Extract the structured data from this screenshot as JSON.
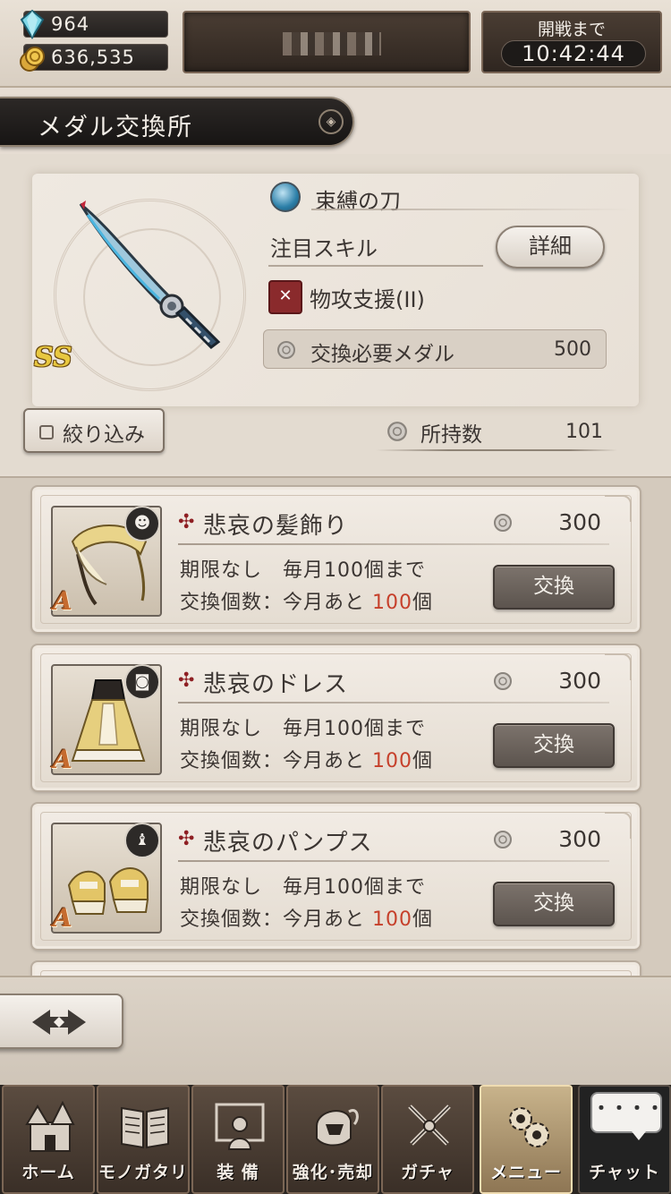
{
  "status": {
    "gems": "964",
    "coins": "636,535",
    "battle_label": "開戦まで",
    "battle_time": "10:42:44"
  },
  "title": "メダル交換所",
  "detail": {
    "weapon_name": "束縛の刀",
    "weapon_rank": "SS",
    "skill_label": "注目スキル",
    "detail_button": "詳細",
    "skill_name": "物攻支援(II)",
    "medal_required_label": "交換必要メダル",
    "medal_required_value": "500",
    "filter_label": "絞り込み",
    "owned_label": "所持数",
    "owned_value": "101"
  },
  "items": [
    {
      "name": "悲哀の髪飾り",
      "cost": "300",
      "rank": "A",
      "limit_text": "期限なし　毎月100個まで",
      "remaining_prefix": "交換個数：今月あと",
      "remaining_count": "100",
      "remaining_suffix": "個",
      "button": "交換",
      "type_icon": "helmet-type-icon"
    },
    {
      "name": "悲哀のドレス",
      "cost": "300",
      "rank": "A",
      "limit_text": "期限なし　毎月100個まで",
      "remaining_prefix": "交換個数：今月あと",
      "remaining_count": "100",
      "remaining_suffix": "個",
      "button": "交換",
      "type_icon": "armor-type-icon"
    },
    {
      "name": "悲哀のパンプス",
      "cost": "300",
      "rank": "A",
      "limit_text": "期限なし　毎月100個まで",
      "remaining_prefix": "交換個数：今月あと",
      "remaining_count": "100",
      "remaining_suffix": "個",
      "button": "交換",
      "type_icon": "foot-type-icon"
    }
  ],
  "nav": {
    "home": "ホーム",
    "story": "モノガタリ",
    "equip": "装 備",
    "enhance": "強化･売却",
    "gacha": "ガチャ",
    "menu": "メニュー",
    "chat": "チャット",
    "chat_bubble": "・・・・"
  },
  "colors": {
    "accent_red": "#c6402b",
    "rank_ss": "#e8c840",
    "rank_a": "#c56b2f"
  }
}
